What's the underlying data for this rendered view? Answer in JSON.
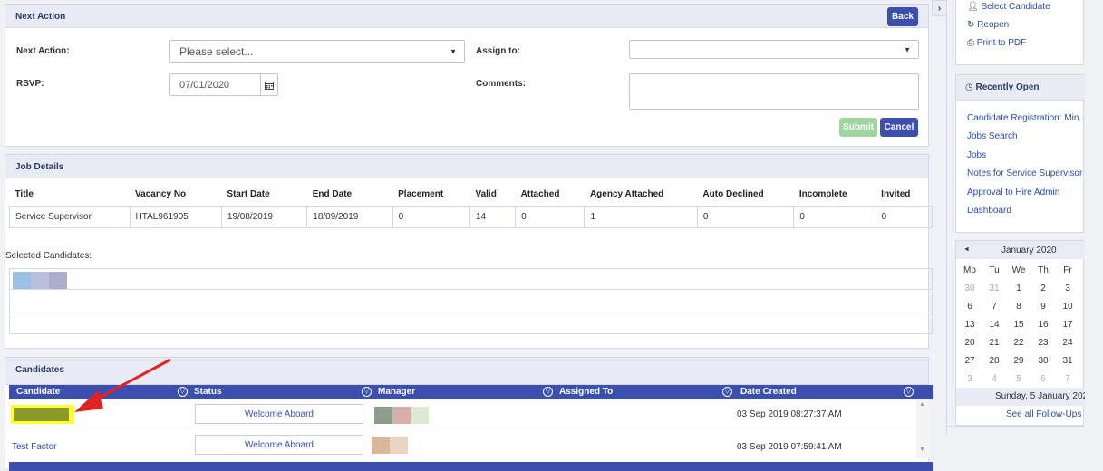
{
  "next_action_panel": {
    "title": "Next Action",
    "back_label": "Back",
    "next_action_label": "Next Action:",
    "next_action_value": "Please select...",
    "assign_to_label": "Assign to:",
    "assign_to_value": "",
    "rsvp_label": "RSVP:",
    "rsvp_value": "07/01/2020",
    "comments_label": "Comments:",
    "comments_value": "",
    "submit_label": "Submit",
    "cancel_label": "Cancel"
  },
  "job_details": {
    "title": "Job Details",
    "columns": [
      "Title",
      "Vacancy No",
      "Start Date",
      "End Date",
      "Placement",
      "Valid",
      "Attached",
      "Agency Attached",
      "Auto Declined",
      "Incomplete",
      "Invited"
    ],
    "row": [
      "Service Supervisor",
      "HTAL961905",
      "19/08/2019",
      "18/09/2019",
      "0",
      "14",
      "0",
      "1",
      "0",
      "0",
      "0"
    ],
    "selected_label": "Selected Candidates:"
  },
  "candidates": {
    "title": "Candidates",
    "columns": [
      "Candidate",
      "Status",
      "Manager",
      "Assigned To",
      "Date Created"
    ],
    "rows": [
      {
        "candidate": "",
        "status": "Welcome Aboard",
        "date": "03 Sep 2019 08:27:37 AM"
      },
      {
        "candidate": "Test Factor",
        "status": "Welcome Aboard",
        "date": "03 Sep 2019 07:59:41 AM"
      }
    ]
  },
  "sidebar": {
    "actions": [
      "Select Candidate",
      "Reopen",
      "Print to PDF"
    ],
    "recent_title": "Recently Open",
    "recent": [
      "Candidate Registration: Min...",
      "Jobs Search",
      "Jobs",
      "Notes for Service Supervisor",
      "Approval to Hire Admin",
      "Dashboard"
    ],
    "calendar": {
      "month": "January 2020",
      "days": [
        "Mo",
        "Tu",
        "We",
        "Th",
        "Fr"
      ],
      "weeks": [
        [
          "30",
          "31",
          "1",
          "2",
          "3"
        ],
        [
          "6",
          "7",
          "8",
          "9",
          "10"
        ],
        [
          "13",
          "14",
          "15",
          "16",
          "17"
        ],
        [
          "20",
          "21",
          "22",
          "23",
          "24"
        ],
        [
          "27",
          "28",
          "29",
          "30",
          "31"
        ],
        [
          "3",
          "4",
          "5",
          "6",
          "7"
        ]
      ],
      "today": "Sunday, 5 January 202",
      "see_all": "See all Follow-Ups"
    }
  },
  "colors": {
    "accent": "#3d4fae",
    "highlight": "#ffff33",
    "arrow": "#e52222"
  }
}
